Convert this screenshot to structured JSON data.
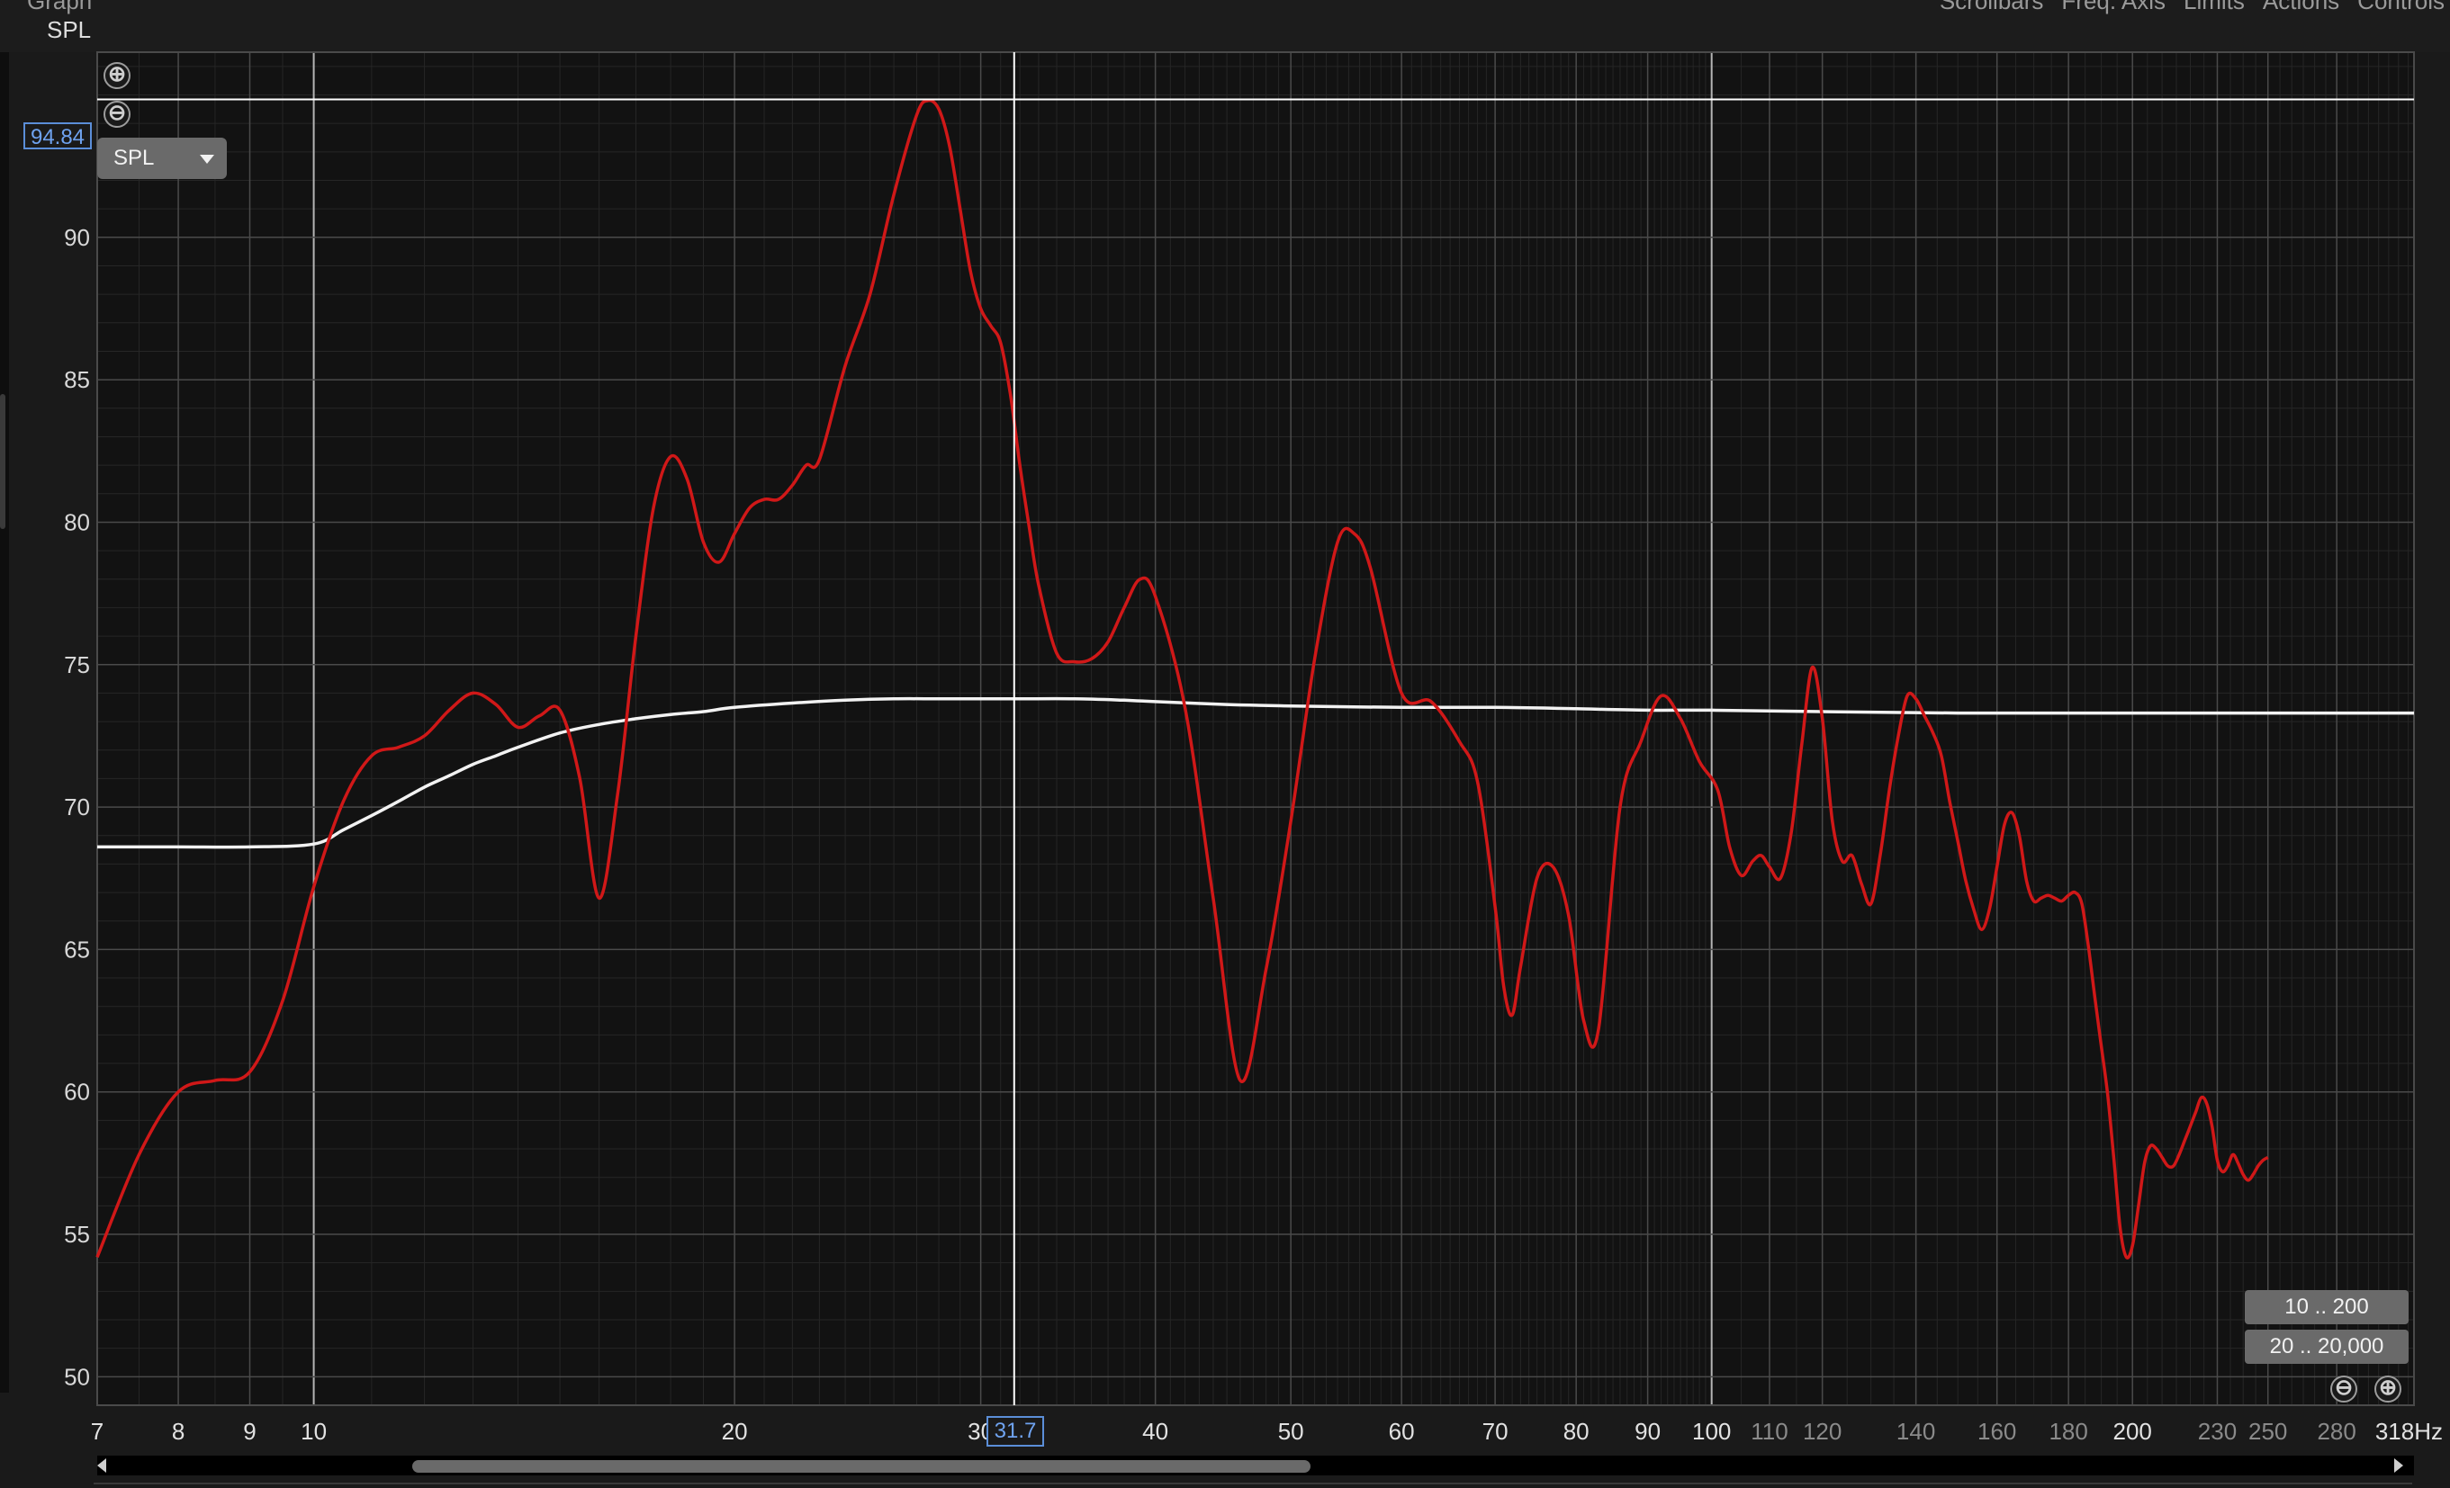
{
  "window": {
    "top_left_label": "Graph",
    "y_axis_title": "SPL",
    "menu": [
      "Scrollbars",
      "Freq. Axis",
      "Limits",
      "Actions",
      "Controls"
    ]
  },
  "controls": {
    "zoom_in_glyph": "⊕",
    "zoom_out_glyph": "⊖",
    "y_selector": "SPL",
    "cursor_y": "94.84",
    "cursor_x": "31.7",
    "preset_1": "10 .. 200",
    "preset_2": "20 .. 20,000"
  },
  "colors": {
    "background": "#121212",
    "measurement": "#d01818",
    "target": "#f2f2f2",
    "cursor": "#ffffff",
    "highlight": "#5b8ed8"
  },
  "icons": [
    "zoom-in-icon",
    "zoom-out-icon",
    "chevron-down-icon",
    "scroll-left-icon",
    "scroll-right-icon"
  ],
  "chart_data": {
    "type": "line",
    "x_scale": "log",
    "xlim": [
      7,
      318
    ],
    "ylim": [
      49,
      96.5
    ],
    "grid": true,
    "x_ticks": [
      {
        "v": 7,
        "label": "7",
        "dim": false
      },
      {
        "v": 8,
        "label": "8",
        "dim": false
      },
      {
        "v": 9,
        "label": "9",
        "dim": false
      },
      {
        "v": 10,
        "label": "10",
        "dim": false
      },
      {
        "v": 20,
        "label": "20",
        "dim": false
      },
      {
        "v": 30,
        "label": "30",
        "dim": false
      },
      {
        "v": 40,
        "label": "40",
        "dim": false
      },
      {
        "v": 50,
        "label": "50",
        "dim": false
      },
      {
        "v": 60,
        "label": "60",
        "dim": false
      },
      {
        "v": 70,
        "label": "70",
        "dim": false
      },
      {
        "v": 80,
        "label": "80",
        "dim": false
      },
      {
        "v": 90,
        "label": "90",
        "dim": false
      },
      {
        "v": 100,
        "label": "100",
        "dim": false
      },
      {
        "v": 110,
        "label": "110",
        "dim": true
      },
      {
        "v": 120,
        "label": "120",
        "dim": true
      },
      {
        "v": 140,
        "label": "140",
        "dim": true
      },
      {
        "v": 160,
        "label": "160",
        "dim": true
      },
      {
        "v": 180,
        "label": "180",
        "dim": true
      },
      {
        "v": 200,
        "label": "200",
        "dim": false
      },
      {
        "v": 230,
        "label": "230",
        "dim": true
      },
      {
        "v": 250,
        "label": "250",
        "dim": true
      },
      {
        "v": 280,
        "label": "280",
        "dim": true
      }
    ],
    "x_end_label": "318Hz",
    "y_ticks": [
      50,
      55,
      60,
      65,
      70,
      75,
      80,
      85,
      90
    ],
    "major_x_lines": [
      10,
      100
    ],
    "cursor": {
      "x": 31.7,
      "y": 94.84
    },
    "series": [
      {
        "role": "measurement",
        "color": "#d01818",
        "x": [
          7,
          7.5,
          8,
          8.5,
          9,
          9.5,
          10,
          10.5,
          11,
          11.5,
          12,
          12.5,
          13,
          13.5,
          14,
          14.5,
          15,
          15.5,
          16,
          16.5,
          17,
          17.5,
          18,
          18.5,
          19,
          19.5,
          20,
          20.5,
          21,
          21.5,
          22,
          22.5,
          23,
          24,
          25,
          26,
          27,
          27.5,
          28,
          28.5,
          29,
          29.5,
          30,
          30.5,
          31,
          31.5,
          32,
          32.5,
          33,
          34,
          35,
          36,
          37,
          38,
          39,
          40,
          42,
          44,
          46,
          48,
          50,
          52,
          54,
          55.5,
          57,
          60,
          63,
          66,
          68,
          70,
          71,
          72,
          73,
          75,
          77,
          79,
          81,
          83,
          86,
          89,
          92,
          95,
          98,
          101,
          103,
          105,
          107,
          108.5,
          110,
          112,
          114,
          116,
          118,
          120,
          122,
          124,
          126,
          128,
          130,
          132,
          134,
          136,
          138,
          140,
          142,
          144,
          146,
          148,
          150,
          152,
          154,
          156,
          158,
          160,
          162,
          164,
          166,
          168,
          170,
          172,
          174,
          176,
          178,
          180,
          182,
          184,
          186,
          188,
          190,
          192,
          194,
          196,
          198,
          200,
          202,
          204,
          206,
          208,
          210,
          212,
          214,
          216,
          218,
          220,
          222,
          224,
          226,
          228,
          230,
          232,
          234,
          236,
          238,
          240,
          242,
          244,
          246,
          248,
          250
        ],
        "values": [
          54.2,
          57.8,
          60,
          60.4,
          60.7,
          63.2,
          67.2,
          70.2,
          71.8,
          72.1,
          72.5,
          73.4,
          74,
          73.6,
          72.8,
          73.2,
          73.4,
          71,
          66.8,
          70.5,
          76,
          80.5,
          82.3,
          81.5,
          79.3,
          78.6,
          79.6,
          80.5,
          80.8,
          80.8,
          81.3,
          82,
          82.2,
          85.5,
          88,
          91.5,
          94.3,
          94.8,
          94.5,
          93.2,
          91,
          88.8,
          87.5,
          86.9,
          86.3,
          84.5,
          82,
          79.8,
          77.8,
          75.4,
          75.1,
          75.2,
          75.8,
          77,
          78,
          77.4,
          73.5,
          66.8,
          60.4,
          64.3,
          69.5,
          75.2,
          79.3,
          79.6,
          78.4,
          74,
          73.7,
          72.3,
          70.9,
          66.5,
          63.7,
          62.7,
          64.4,
          67.5,
          67.9,
          66.2,
          62.5,
          62.2,
          70,
          72.3,
          73.9,
          73.1,
          71.6,
          70.6,
          68.6,
          67.6,
          68.1,
          68.3,
          67.9,
          67.5,
          69.1,
          72.2,
          74.9,
          73.1,
          69.5,
          68.1,
          68.3,
          67.3,
          66.6,
          68.3,
          70.6,
          72.5,
          73.9,
          73.8,
          73.2,
          72.6,
          71.8,
          70.2,
          68.8,
          67.4,
          66.4,
          65.7,
          66.4,
          67.9,
          69.4,
          69.8,
          69,
          67.4,
          66.7,
          66.8,
          66.9,
          66.8,
          66.7,
          66.9,
          67,
          66.6,
          65.1,
          63.3,
          61.6,
          59.9,
          57.6,
          55.2,
          54.2,
          54.6,
          56,
          57.5,
          58.1,
          58,
          57.7,
          57.4,
          57.4,
          57.8,
          58.3,
          58.8,
          59.3,
          59.8,
          59.6,
          58.8,
          57.6,
          57.2,
          57.4,
          57.8,
          57.5,
          57.1,
          56.9,
          57.1,
          57.4,
          57.6,
          57.7
        ]
      },
      {
        "role": "target",
        "color": "#f2f2f2",
        "x": [
          7,
          8,
          9,
          10,
          10.5,
          11,
          11.5,
          12,
          12.5,
          13,
          13.5,
          14,
          15,
          16,
          17,
          18,
          19,
          20,
          22,
          24,
          26,
          28,
          30,
          32,
          35,
          38,
          40,
          45,
          50,
          60,
          70,
          80,
          90,
          100,
          120,
          150,
          200,
          250,
          318
        ],
        "values": [
          68.6,
          68.6,
          68.6,
          68.7,
          69.2,
          69.7,
          70.2,
          70.7,
          71.1,
          71.5,
          71.8,
          72.1,
          72.6,
          72.9,
          73.1,
          73.25,
          73.35,
          73.5,
          73.65,
          73.75,
          73.8,
          73.8,
          73.8,
          73.8,
          73.8,
          73.75,
          73.7,
          73.6,
          73.55,
          73.5,
          73.5,
          73.45,
          73.4,
          73.4,
          73.35,
          73.3,
          73.3,
          73.3,
          73.3
        ]
      }
    ]
  }
}
